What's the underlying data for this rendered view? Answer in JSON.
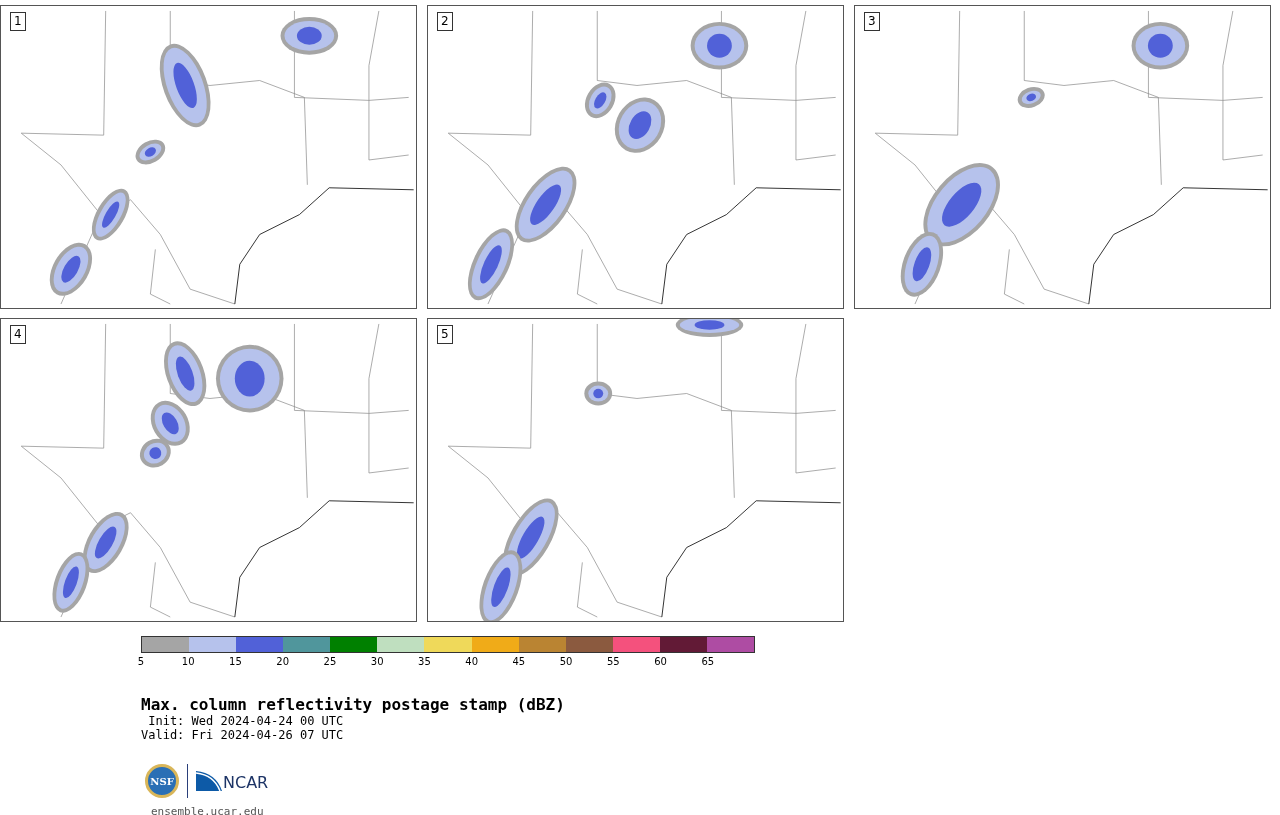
{
  "panels": [
    {
      "label": "1"
    },
    {
      "label": "2"
    },
    {
      "label": "3"
    },
    {
      "label": "4"
    },
    {
      "label": "5"
    }
  ],
  "colorbar": {
    "segments": [
      {
        "color": "#a5a5a5"
      },
      {
        "color": "#b6c2ec"
      },
      {
        "color": "#5161d8"
      },
      {
        "color": "#50969c"
      },
      {
        "color": "#008000"
      },
      {
        "color": "#bfdfbf"
      },
      {
        "color": "#efd95a"
      },
      {
        "color": "#f0ab18"
      },
      {
        "color": "#ba8432"
      },
      {
        "color": "#8b5a3f"
      },
      {
        "color": "#f4517d"
      },
      {
        "color": "#621a36"
      },
      {
        "color": "#ae4ca3"
      }
    ],
    "ticks": [
      "5",
      "10",
      "15",
      "20",
      "25",
      "30",
      "35",
      "40",
      "45",
      "50",
      "55",
      "60",
      "65"
    ]
  },
  "title": "Max. column reflectivity postage stamp (dBZ)",
  "init": " Init: Wed 2024-04-24 00 UTC",
  "valid": "Valid: Fri 2024-04-26 07 UTC",
  "logos": {
    "nsf": "NSF",
    "ncar": "NCAR"
  },
  "website": "ensemble.ucar.edu"
}
